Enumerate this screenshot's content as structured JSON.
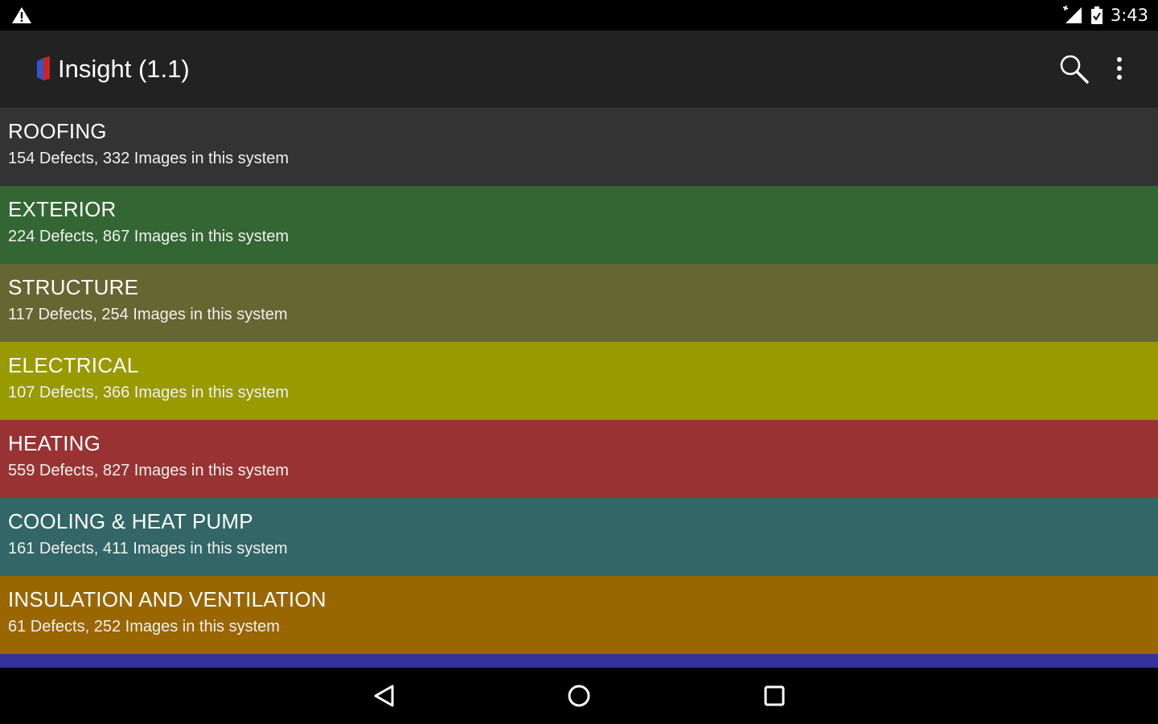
{
  "status_bar": {
    "time": "3:43",
    "icons": [
      "warning-icon",
      "signal-icon",
      "battery-icon"
    ]
  },
  "app_bar": {
    "title": "Insight (1.1)",
    "actions": [
      "search-icon",
      "overflow-menu-icon"
    ],
    "background": "#222222"
  },
  "systems": [
    {
      "name": "ROOFING",
      "summary": "154 Defects, 332 Images in this system",
      "color": "#333333"
    },
    {
      "name": "EXTERIOR",
      "summary": "224 Defects, 867 Images in this system",
      "color": "#336633"
    },
    {
      "name": "STRUCTURE",
      "summary": "117 Defects, 254 Images in this system",
      "color": "#666633"
    },
    {
      "name": "ELECTRICAL",
      "summary": "107 Defects, 366 Images in this system",
      "color": "#999900"
    },
    {
      "name": "HEATING",
      "summary": "559 Defects, 827 Images in this system",
      "color": "#993333"
    },
    {
      "name": "COOLING & HEAT PUMP",
      "summary": "161 Defects, 411 Images in this system",
      "color": "#336666"
    },
    {
      "name": "INSULATION AND VENTILATION",
      "summary": "61 Defects, 252 Images in this system",
      "color": "#996600"
    }
  ],
  "partial_row_color": "#333399",
  "nav_bar": {
    "buttons": [
      "back-icon",
      "home-icon",
      "recents-icon"
    ]
  }
}
